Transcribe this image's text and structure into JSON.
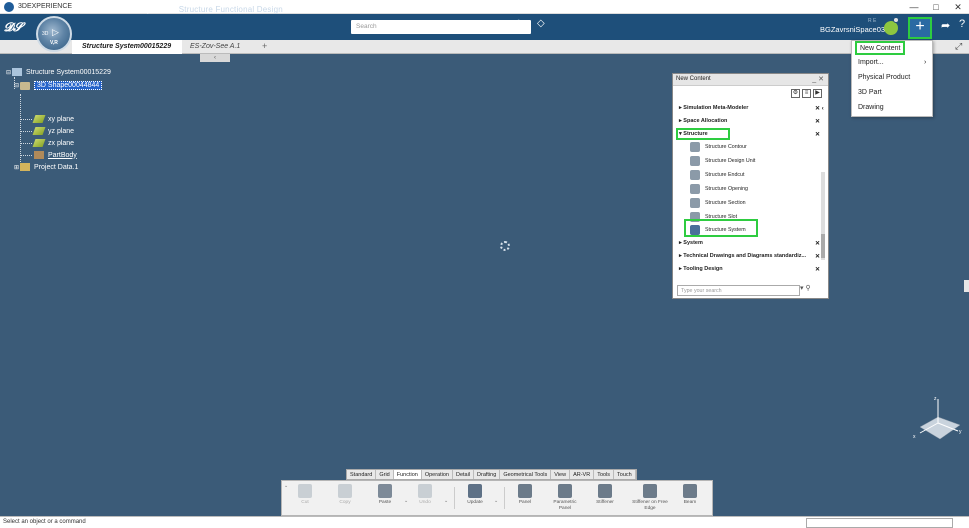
{
  "os": {
    "title": "3DEXPERIENCE",
    "controls": [
      "—",
      "□",
      "✕"
    ]
  },
  "header": {
    "brand_bold": "3DEXPERIENCE | CATIA",
    "brand_sub": "Structure Functional Design",
    "search_placeholder": "Search",
    "user": "BGZavrsniSpace03",
    "space_tag": "R E",
    "compass_version": "V,R",
    "compass_3d": "3D"
  },
  "tabs": {
    "active": "Structure System00015229",
    "second": "ES-Zov-See A.1",
    "add": "+"
  },
  "tree": {
    "root": "Structure System00015229",
    "selected": "3D Shape00044844",
    "children": [
      "xy plane",
      "yz plane",
      "zx plane",
      "PartBody"
    ],
    "sibling": "Project Data.1"
  },
  "menu": {
    "items": [
      "New Content",
      "Import...",
      "Physical Product",
      "3D Part",
      "Drawing"
    ]
  },
  "new_content": {
    "title": "New Content",
    "header_controls": "_ ✕",
    "categories_top": [
      "Simulation Meta-Modeler",
      "Space Allocation"
    ],
    "expanded": "Structure",
    "structure_items": [
      "Structure Contour",
      "Structure Design Unit",
      "Structure Endcut",
      "Structure Opening",
      "Structure Section",
      "Structure Slot",
      "Structure System"
    ],
    "categories_bottom": [
      "System",
      "Technical Drawings and Diagrams standardiz...",
      "Tooling Design"
    ],
    "search_placeholder": "Type your search"
  },
  "action_tabs": [
    "Standard",
    "Grid",
    "Function",
    "Operation",
    "Detail",
    "Drafting",
    "Geometrical Tools",
    "View",
    "AR-VR",
    "Tools",
    "Touch"
  ],
  "active_action_tab": "Function",
  "actions": [
    {
      "label": "Cut",
      "disabled": true
    },
    {
      "label": "Copy",
      "disabled": true
    },
    {
      "label": "Paste",
      "disabled": false
    },
    {
      "label": "Undo",
      "disabled": true
    },
    {
      "label": "Update",
      "disabled": false
    },
    {
      "label": "Panel",
      "disabled": false
    },
    {
      "label": "Parametric Panel",
      "disabled": false
    },
    {
      "label": "Stiffener",
      "disabled": false
    },
    {
      "label": "Stiffener on Free Edge",
      "disabled": false
    },
    {
      "label": "Beam",
      "disabled": false
    }
  ],
  "status": {
    "text": "Select an object or a command"
  },
  "axis": {
    "x": "x",
    "y": "y",
    "z": "z"
  },
  "colors": {
    "header": "#1e4f7a",
    "viewport": "#3b5b78",
    "highlight": "#2ecc40",
    "selection": "#2563c9"
  }
}
